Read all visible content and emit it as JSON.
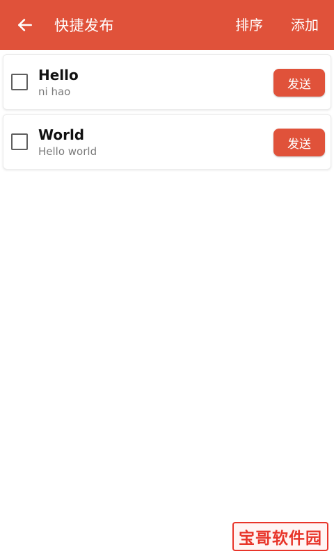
{
  "header": {
    "title": "快捷发布",
    "back_icon": "arrow-left-icon",
    "sort_label": "排序",
    "add_label": "添加",
    "color": "#e0523a"
  },
  "items": [
    {
      "title": "Hello",
      "subtitle": "ni hao",
      "send_label": "发送",
      "checked": false
    },
    {
      "title": "World",
      "subtitle": "Hello world",
      "send_label": "发送",
      "checked": false
    }
  ],
  "watermark": {
    "text": "宝哥软件园"
  }
}
